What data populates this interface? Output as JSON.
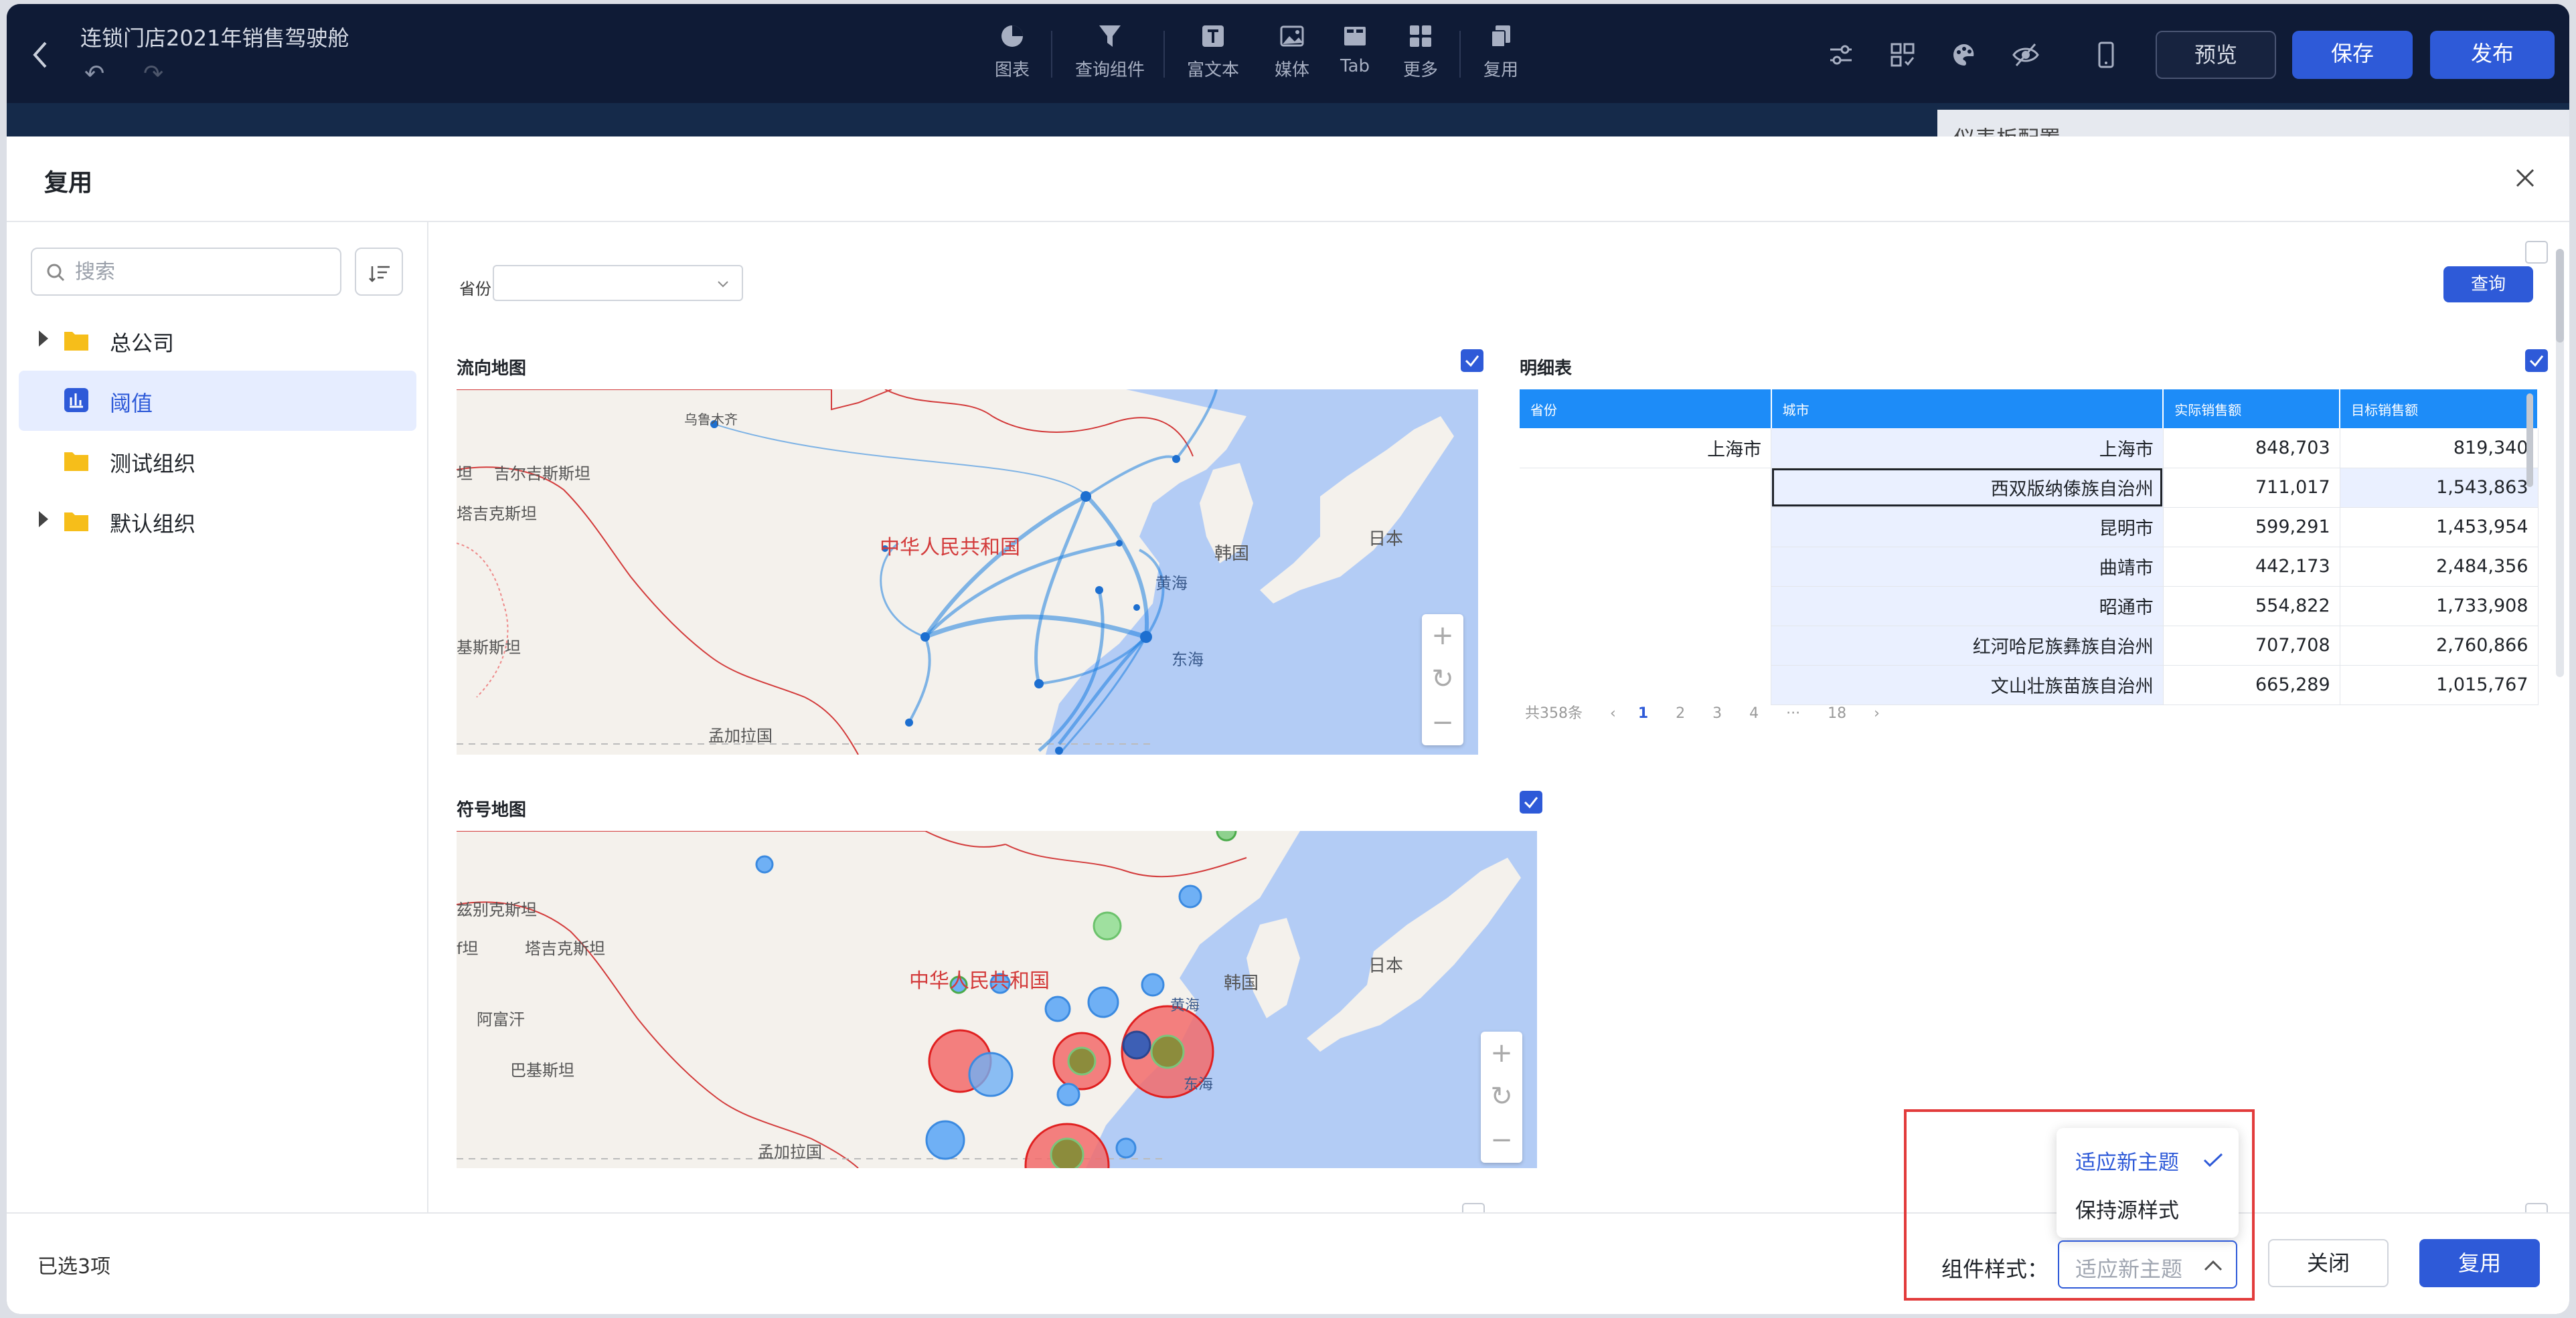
{
  "topbar": {
    "title": "连锁门店2021年销售驾驶舱",
    "tools": [
      {
        "label": "图表",
        "icon": "chart-pie-icon"
      },
      {
        "label": "查询组件",
        "icon": "filter-icon"
      },
      {
        "label": "富文本",
        "icon": "text-icon"
      },
      {
        "label": "媒体",
        "icon": "image-icon"
      },
      {
        "label": "Tab",
        "icon": "tab-icon"
      },
      {
        "label": "更多",
        "icon": "grid-icon"
      },
      {
        "label": "复用",
        "icon": "copy-icon"
      }
    ],
    "preview_label": "预览",
    "save_label": "保存",
    "publish_label": "发布"
  },
  "background_panel_title": "仪表板配置",
  "modal": {
    "title": "复用",
    "search_placeholder": "搜索",
    "tree": [
      {
        "label": "总公司",
        "expandable": true,
        "icon": "folder-icon"
      },
      {
        "label": "阈值",
        "expandable": false,
        "icon": "chart-bar-icon",
        "active": true
      },
      {
        "label": "测试组织",
        "expandable": false,
        "icon": "folder-icon"
      },
      {
        "label": "默认组织",
        "expandable": true,
        "icon": "folder-icon"
      }
    ],
    "filter_label": "省份",
    "query_label": "查询",
    "flow_map": {
      "title": "流向地图",
      "labels": {
        "china": "中华人民共和国",
        "korea": "韩国",
        "japan": "日本",
        "yellow_sea": "黄海",
        "east_sea": "东海",
        "kyrgyz": "吉尔吉斯斯坦",
        "tajik": "塔吉克斯坦",
        "pakistan": "基斯斯坦",
        "bangladesh": "孟加拉国",
        "urumqi": "乌鲁木齐",
        "west": "坦"
      }
    },
    "symbol_map": {
      "title": "符号地图",
      "labels": {
        "china": "中华人民共和国",
        "korea": "韩国",
        "japan": "日本",
        "yellow_sea": "黄海",
        "east_sea": "东海",
        "uzbek": "兹别克斯坦",
        "tajik": "塔吉克斯坦",
        "afghan": "阿富汗",
        "pakistan": "巴基斯坦",
        "bangladesh": "孟加拉国",
        "west": "f坦"
      }
    },
    "detail_table": {
      "title": "明细表",
      "columns": [
        "省份",
        "城市",
        "实际销售额",
        "目标销售额"
      ],
      "province": "上海市",
      "rows": [
        {
          "city": "上海市",
          "actual": "848,703",
          "target": "819,340"
        },
        {
          "city": "西双版纳傣族自治州",
          "actual": "711,017",
          "target": "1,543,863"
        },
        {
          "city": "昆明市",
          "actual": "599,291",
          "target": "1,453,954"
        },
        {
          "city": "曲靖市",
          "actual": "442,173",
          "target": "2,484,356"
        },
        {
          "city": "昭通市",
          "actual": "554,822",
          "target": "1,733,908"
        },
        {
          "city": "红河哈尼族彝族自治州",
          "actual": "707,708",
          "target": "2,760,866"
        },
        {
          "city": "文山壮族苗族自治州",
          "actual": "665,289",
          "target": "1,015,767"
        }
      ],
      "pager": {
        "total": "共358条",
        "pages": [
          "1",
          "2",
          "3",
          "4",
          "···",
          "18"
        ],
        "current": "1"
      }
    },
    "footer": {
      "selected": "已选3项",
      "style_label": "组件样式：",
      "style_value": "适应新主题",
      "options": [
        "适应新主题",
        "保持源样式"
      ],
      "close_label": "关闭",
      "reuse_label": "复用"
    }
  },
  "colors": {
    "accent": "#2e5ad8",
    "header_bg": "#0f1b36",
    "table_header": "#1d8cf8",
    "highlight_box": "#e23b3b",
    "sea": "#b3ccf5",
    "land": "#f4f1ec"
  }
}
